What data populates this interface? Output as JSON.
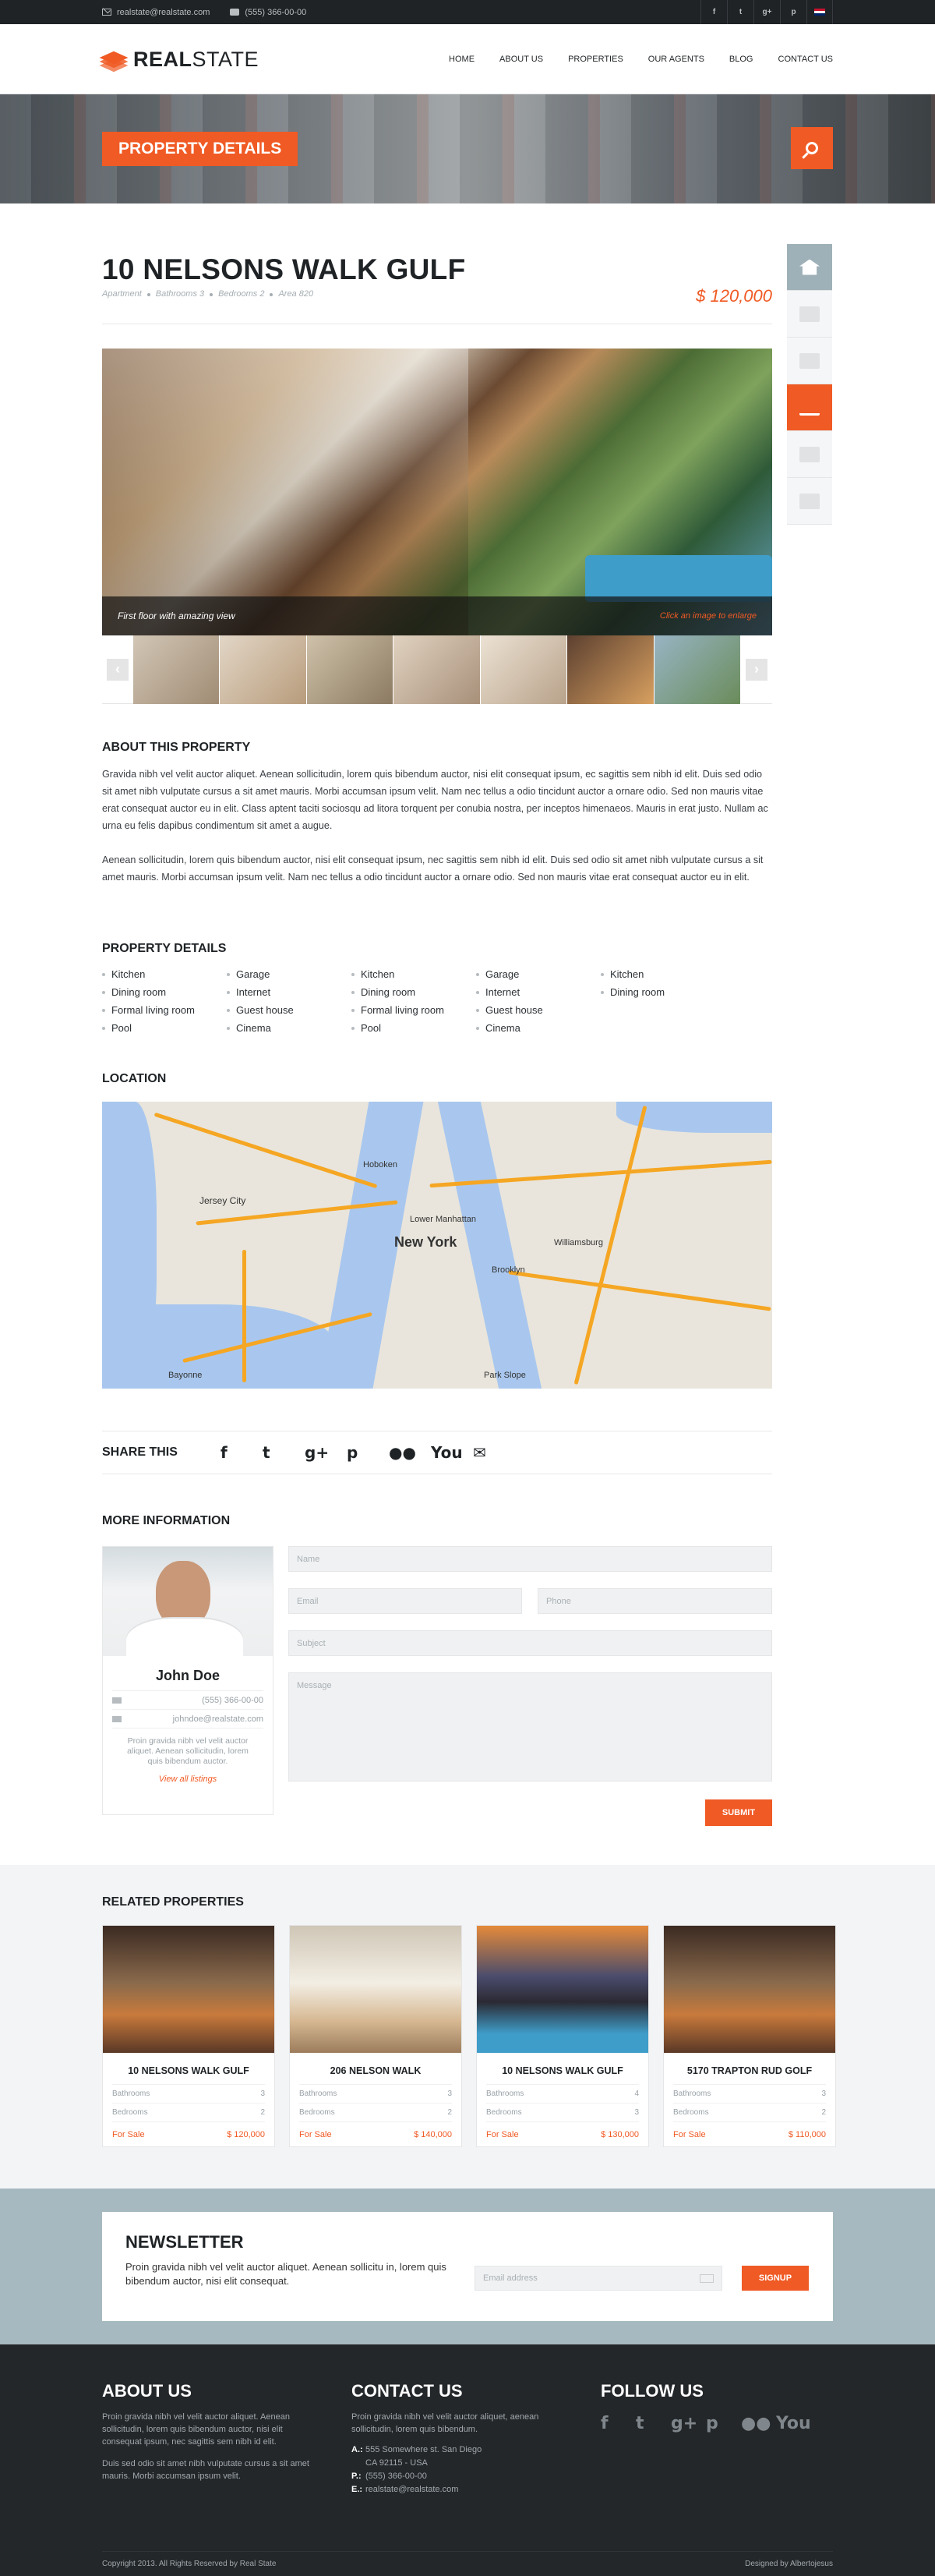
{
  "topbar": {
    "email": "realstate@realstate.com",
    "phone": "(555) 366-00-00",
    "social": [
      "f",
      "t",
      "g+",
      "p"
    ]
  },
  "logo": {
    "bold": "REAL",
    "rest": "STATE"
  },
  "nav": [
    "HOME",
    "ABOUT US",
    "PROPERTIES",
    "OUR AGENTS",
    "BLOG",
    "CONTACT US"
  ],
  "banner": {
    "title": "PROPERTY DETAILS"
  },
  "property": {
    "title": "10 NELSONS WALK GULF",
    "meta": [
      "Apartment",
      "Bathrooms 3",
      "Bedrooms 2",
      "Area 820"
    ],
    "price": "$ 120,000",
    "caption": "First floor with amazing view",
    "caption_hint": "Click an image to enlarge"
  },
  "about": {
    "title": "ABOUT THIS PROPERTY",
    "p1": "Gravida nibh vel velit auctor aliquet. Aenean sollicitudin, lorem quis bibendum auctor, nisi elit consequat ipsum, ec sagittis sem nibh id elit. Duis sed odio sit amet nibh vulputate cursus a sit amet mauris. Morbi accumsan ipsum velit. Nam nec tellus a odio tincidunt auctor a ornare odio. Sed non  mauris vitae erat consequat auctor eu in elit. Class aptent taciti sociosqu ad litora torquent per conubia nostra, per inceptos himenaeos. Mauris in erat justo. Nullam ac urna eu felis dapibus condimentum sit amet a augue.",
    "p2": "Aenean sollicitudin, lorem quis bibendum auctor, nisi elit consequat ipsum, nec sagittis sem nibh id elit. Duis sed odio sit amet nibh vulputate cursus a sit amet mauris. Morbi accumsan ipsum velit. Nam nec tellus a odio tincidunt auctor a ornare odio. Sed non mauris vitae erat consequat auctor eu in elit."
  },
  "details": {
    "title": "PROPERTY DETAILS",
    "columns": [
      [
        "Kitchen",
        "Dining room",
        "Formal living room",
        "Pool"
      ],
      [
        "Garage",
        "Internet",
        "Guest house",
        "Cinema"
      ],
      [
        "Kitchen",
        "Dining room",
        "Formal living room",
        "Pool"
      ],
      [
        "Garage",
        "Internet",
        "Guest house",
        "Cinema"
      ],
      [
        "Kitchen",
        "Dining room"
      ]
    ]
  },
  "location": {
    "title": "LOCATION",
    "city": "New York",
    "places": [
      "Jersey City",
      "Hoboken",
      "Lower Manhattan",
      "Brooklyn",
      "Bayonne",
      "Williamsburg",
      "Park Slope"
    ]
  },
  "share": {
    "title": "SHARE THIS",
    "icons": [
      "f",
      "t",
      "g+",
      "p",
      "●●",
      "You",
      "✉"
    ]
  },
  "more": {
    "title": "MORE INFORMATION",
    "agent": {
      "name": "John Doe",
      "phone": "(555) 366-00-00",
      "email": "johndoe@realstate.com",
      "text": "Proin gravida nibh vel velit auctor aliquet. Aenean sollicitudin, lorem quis bibendum auctor.",
      "link": "View all listings"
    },
    "form": {
      "name": "Name",
      "email": "Email",
      "phone": "Phone",
      "subject": "Subject",
      "message": "Message",
      "submit": "SUBMIT"
    }
  },
  "related": {
    "title": "RELATED PROPERTIES",
    "labels": {
      "baths": "Bathrooms",
      "beds": "Bedrooms"
    },
    "cards": [
      {
        "title": "10 NELSONS WALK GULF",
        "baths": "3",
        "beds": "2",
        "status": "For Sale",
        "price": "$ 120,000"
      },
      {
        "title": "206 NELSON WALK",
        "baths": "3",
        "beds": "2",
        "status": "For Sale",
        "price": "$ 140,000"
      },
      {
        "title": "10 NELSONS WALK GULF",
        "baths": "4",
        "beds": "3",
        "status": "For Sale",
        "price": "$ 130,000"
      },
      {
        "title": "5170 TRAPTON RUD GOLF",
        "baths": "3",
        "beds": "2",
        "status": "For Sale",
        "price": "$ 110,000"
      }
    ]
  },
  "newsletter": {
    "title": "NEWSLETTER",
    "text": "Proin gravida nibh vel velit auctor aliquet. Aenean sollicitu in, lorem quis bibendum auctor, nisi elit consequat.",
    "placeholder": "Email address",
    "button": "SIGNUP"
  },
  "footer": {
    "about_title": "ABOUT US",
    "about_p1": "Proin gravida nibh vel velit auctor aliquet. Aenean sollicitudin, lorem quis bibendum auctor, nisi elit consequat ipsum, nec sagittis sem nibh id elit.",
    "about_p2": "Duis sed odio sit amet nibh vulputate cursus a sit amet mauris. Morbi accumsan ipsum velit.",
    "contact_title": "CONTACT US",
    "contact_p": "Proin gravida nibh vel velit auctor aliquet, aenean sollicitudin, lorem quis bibendum.",
    "address": "555 Somewhere st. San Diego",
    "address2": "CA 92115 - USA",
    "phone": "(555) 366-00-00",
    "email": "realstate@realstate.com",
    "follow_title": "FOLLOW US",
    "follow_icons": [
      "f",
      "t",
      "g+",
      "p",
      "●●",
      "You"
    ],
    "copyright": "Copyright 2013. All Rights Reserved by Real State",
    "credit": "Designed by Albertojesus"
  },
  "colors": {
    "accent": "#f05a24",
    "dark": "#1f2326",
    "slate": "#a6b9c0"
  }
}
